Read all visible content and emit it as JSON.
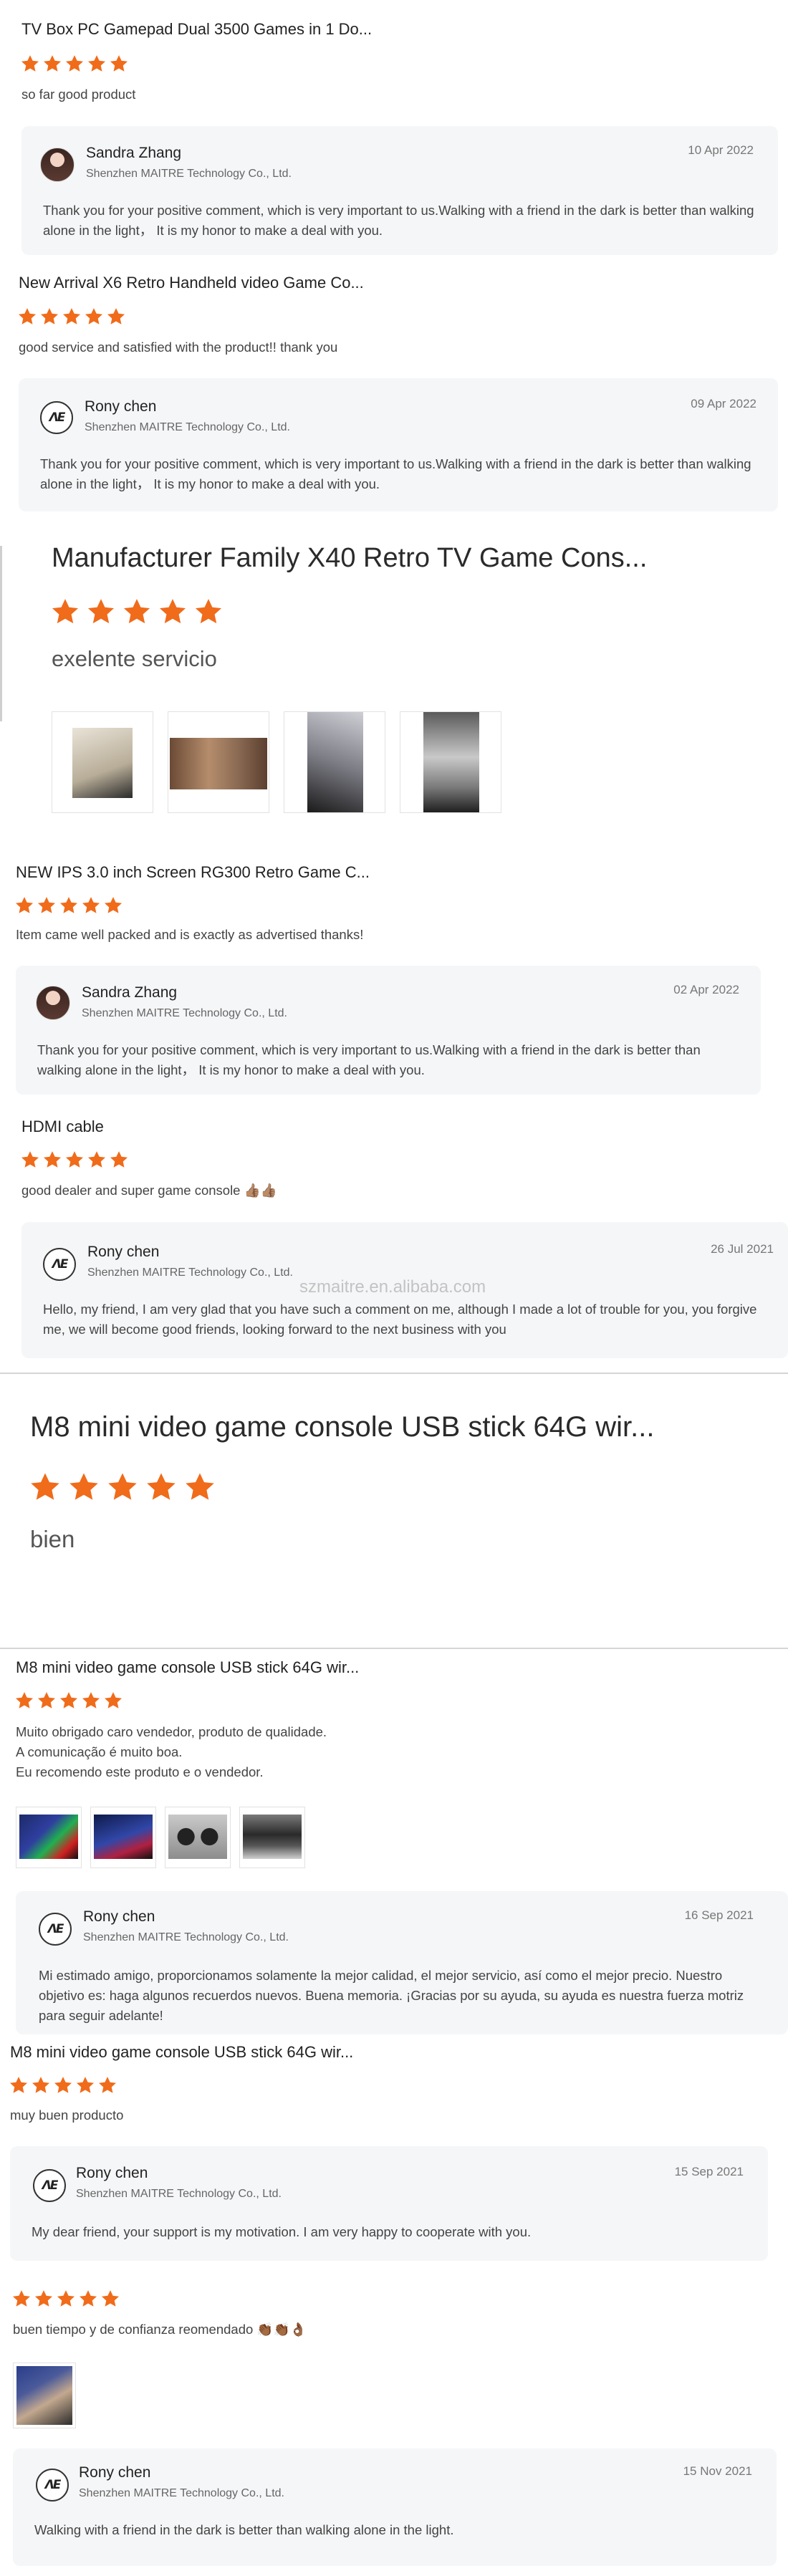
{
  "colors": {
    "star": "#f06b1a",
    "reply_bg": "#f5f6f8"
  },
  "watermark": "szmaitre.en.alibaba.com",
  "reviews": [
    {
      "title": "TV Box PC Gamepad Dual 3500 Games in 1 Do...",
      "rating": 5,
      "comment": "so far good product",
      "reply": {
        "name": "Sandra Zhang",
        "company": "Shenzhen MAITRE Technology Co., Ltd.",
        "date": "10 Apr 2022",
        "avatar": "person-photo-icon",
        "text": "Thank you for your positive comment, which is very important to us.Walking with a friend in the dark is better than walking alone in the light，  It is my honor to make a deal with you."
      }
    },
    {
      "title": "New Arrival X6 Retro Handheld video Game Co...",
      "rating": 5,
      "comment": "good service and satisfied with the product!! thank you",
      "reply": {
        "name": "Rony chen",
        "company": "Shenzhen MAITRE Technology Co., Ltd.",
        "date": "09 Apr 2022",
        "avatar": "maitre-logo-icon",
        "logo_text": "ΛE",
        "text": "Thank you for your positive comment, which is very important to us.Walking with a friend in the dark is better than walking alone in the light，  It is my honor to make a deal with you."
      }
    },
    {
      "title": "Manufacturer Family X40 Retro TV Game Cons...",
      "rating": 5,
      "comment": "exelente servicio",
      "images": [
        "product-box-photo",
        "package-photo",
        "wrapped-parcel-photo",
        "parcel-photo"
      ]
    },
    {
      "title": "NEW IPS 3.0 inch Screen RG300 Retro Game C...",
      "rating": 5,
      "comment": "Item came well packed and is exactly as advertised thanks!",
      "reply": {
        "name": "Sandra Zhang",
        "company": "Shenzhen MAITRE Technology Co., Ltd.",
        "date": "02 Apr 2022",
        "avatar": "person-photo-icon",
        "text": "Thank you for your positive comment, which is very important to us.Walking with a friend in the dark is better than walking alone in the light，  It is my honor to make a deal with you."
      }
    },
    {
      "title": "HDMI cable",
      "rating": 5,
      "comment": "good dealer and super game console 👍🏽👍🏽",
      "reply": {
        "name": "Rony chen",
        "company": "Shenzhen MAITRE Technology Co., Ltd.",
        "date": "26 Jul 2021",
        "avatar": "maitre-logo-icon",
        "logo_text": "ΛE",
        "text": "Hello, my friend, I am very glad that you have such a comment on me, although I made a lot of trouble for you, you forgive me, we will become good friends, looking forward to the next business with you"
      }
    },
    {
      "title": "M8 mini video game console USB stick 64G wir...",
      "rating": 5,
      "comment": "bien"
    },
    {
      "title": "M8 mini video game console USB stick 64G wir...",
      "rating": 5,
      "comment": "Muito obrigado caro vendedor, produto de qualidade.\nA comunicação é muito boa.\nEu recomendo este produto e o vendedor.",
      "images": [
        "game-screen-photo",
        "game-menu-photo",
        "controllers-photo",
        "console-photo"
      ],
      "reply": {
        "name": "Rony chen",
        "company": "Shenzhen MAITRE Technology Co., Ltd.",
        "date": "16 Sep 2021",
        "avatar": "maitre-logo-icon",
        "logo_text": "ΛE",
        "text": "Mi estimado amigo, proporcionamos solamente la mejor calidad, el mejor servicio, así como el mejor precio. Nuestro objetivo es: haga algunos recuerdos nuevos. Buena memoria. ¡Gracias por su ayuda, su ayuda es nuestra fuerza motriz para seguir adelante!"
      }
    },
    {
      "title": "M8 mini video game console USB stick 64G wir...",
      "rating": 5,
      "comment": "muy buen producto",
      "reply": {
        "name": "Rony chen",
        "company": "Shenzhen MAITRE Technology Co., Ltd.",
        "date": "15 Sep 2021",
        "avatar": "maitre-logo-icon",
        "logo_text": "ΛE",
        "text": "My dear friend, your support is my motivation. I am very happy to cooperate with you."
      }
    },
    {
      "title": "",
      "rating": 5,
      "comment": "buen tiempo y de confianza reomendado 👏🏾👏🏾👌🏾",
      "images": [
        "console-hand-photo"
      ],
      "reply": {
        "name": "Rony chen",
        "company": "Shenzhen MAITRE Technology Co., Ltd.",
        "date": "15 Nov 2021",
        "avatar": "maitre-logo-icon",
        "logo_text": "ΛE",
        "text": "Walking with a friend in the dark is better than walking alone in the light."
      }
    }
  ]
}
